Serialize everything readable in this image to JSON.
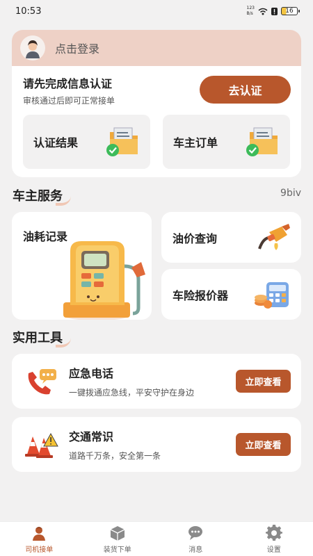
{
  "status_bar": {
    "time": "10:53",
    "net_speed_top": "123",
    "net_speed_bottom": "B/s",
    "battery": "16"
  },
  "login": {
    "prompt": "点击登录"
  },
  "verify": {
    "title": "请先完成信息认证",
    "subtitle": "审核通过后即可正常接单",
    "button": "去认证",
    "cards": [
      {
        "label": "认证结果"
      },
      {
        "label": "车主订单"
      }
    ]
  },
  "owner_service": {
    "title": "车主服务",
    "side_text": "9biv",
    "items": [
      {
        "label": "油耗记录"
      },
      {
        "label": "油价查询"
      },
      {
        "label": "车险报价器"
      }
    ]
  },
  "tools": {
    "title": "实用工具",
    "items": [
      {
        "title": "应急电话",
        "subtitle": "一键拨通应急线，平安守护在身边",
        "button": "立即查看"
      },
      {
        "title": "交通常识",
        "subtitle": "道路千万条，安全第一条",
        "button": "立即查看"
      }
    ]
  },
  "nav": {
    "items": [
      {
        "label": "司机接单",
        "icon": "driver-icon",
        "active": true
      },
      {
        "label": "装货下单",
        "icon": "box-icon",
        "active": false
      },
      {
        "label": "消息",
        "icon": "message-icon",
        "active": false
      },
      {
        "label": "设置",
        "icon": "gear-icon",
        "active": false
      }
    ]
  },
  "colors": {
    "accent": "#b8572c",
    "header": "#eed1c6",
    "background": "#f2f1f1"
  }
}
